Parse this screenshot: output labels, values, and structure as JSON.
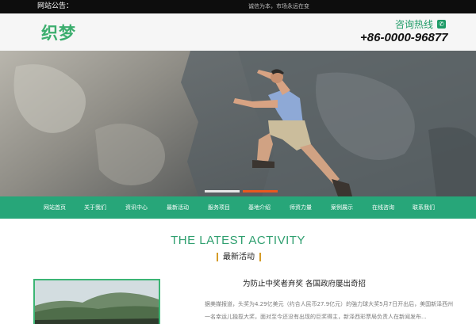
{
  "notice": {
    "label": "网站公告：",
    "text": "诚信为本，市场永远在变"
  },
  "header": {
    "logo": "织梦",
    "hotline_label": "咨询热线",
    "hotline_number": "+86-0000-96877",
    "phone_icon": "phone-icon"
  },
  "banner": {
    "slide_count": 2,
    "active_slide": 2
  },
  "nav": {
    "items": [
      "网站首页",
      "关于我们",
      "资讯中心",
      "最新活动",
      "服务项目",
      "基地介绍",
      "师资力量",
      "案例展示",
      "在线咨询",
      "联系我们"
    ]
  },
  "section": {
    "title": "THE LATEST ACTIVITY",
    "subtitle": "最新活动"
  },
  "article": {
    "title": "为防止中奖者弃奖 各国政府屡出奇招",
    "line1": "据美媒报道，头奖为4.29亿美元（约合人民币27.9亿元）的強力球大奖5月7日开出后，美国新泽西州",
    "line2": "一名幸运儿独揽大奖，面对至今还没有出现的巨奖得主，新泽西彩票局负责人在新闻发布..."
  },
  "colors": {
    "brand_green": "#27a679",
    "logo_green": "#3cae6e",
    "accent_orange": "#e8581f",
    "accent_gold": "#d59b27"
  }
}
